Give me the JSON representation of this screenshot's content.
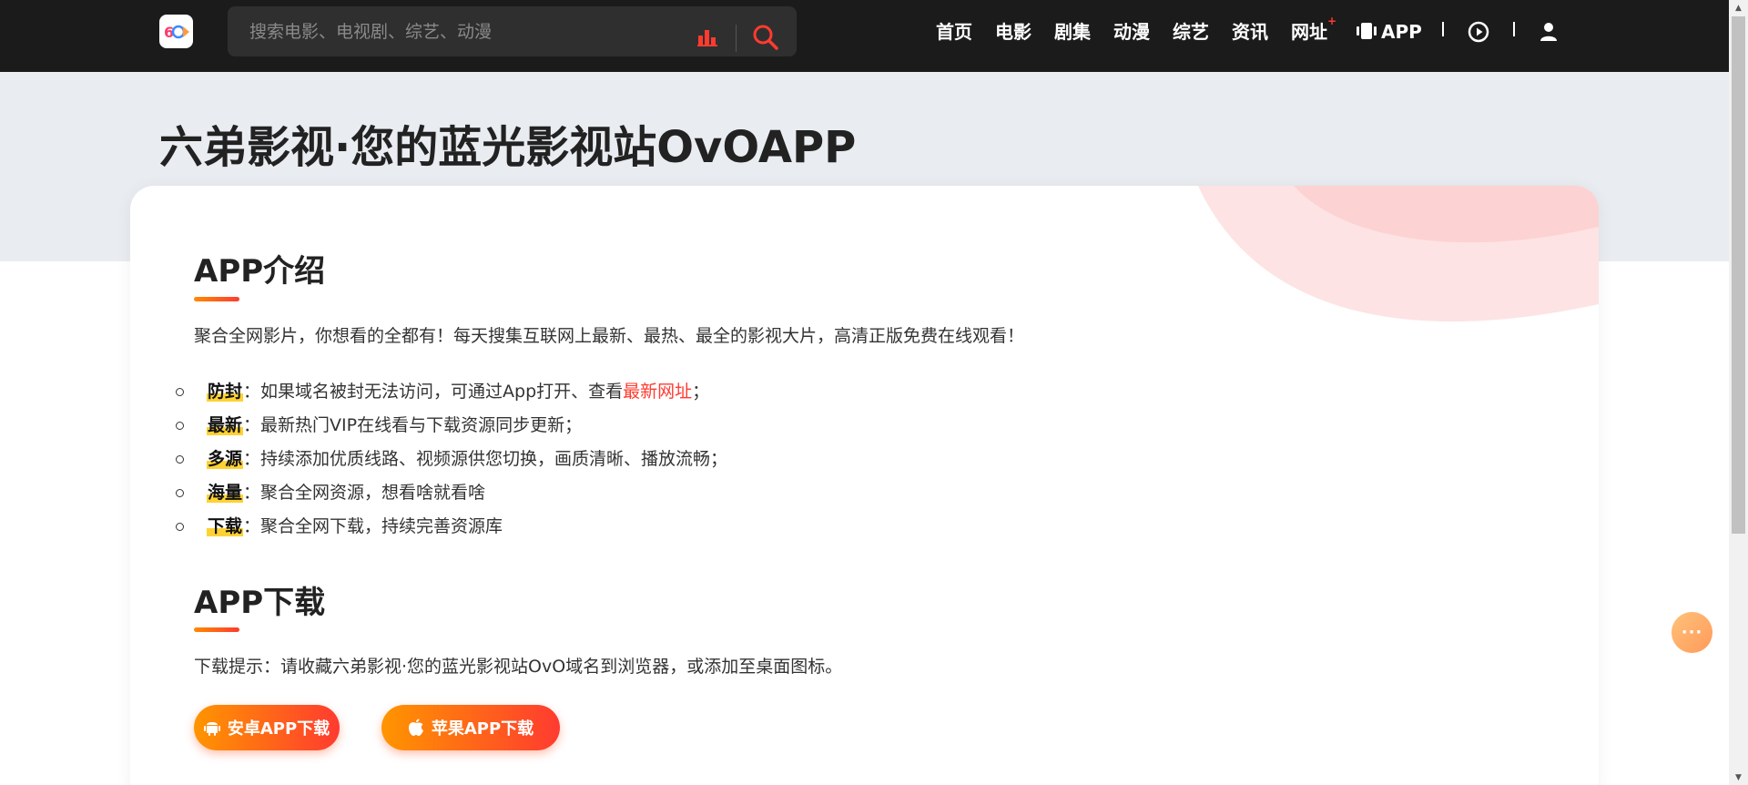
{
  "header": {
    "logo_alt": "六弟影视",
    "search": {
      "placeholder": "搜索电影、电视剧、综艺、动漫"
    },
    "nav": [
      {
        "label": "首页"
      },
      {
        "label": "电影"
      },
      {
        "label": "剧集"
      },
      {
        "label": "动漫"
      },
      {
        "label": "综艺"
      },
      {
        "label": "资讯"
      },
      {
        "label": "网址"
      },
      {
        "label": "APP"
      }
    ],
    "nav_badge": "+"
  },
  "page": {
    "title": "六弟影视·您的蓝光影视站OvOAPP"
  },
  "intro": {
    "heading": "APP介绍",
    "description": "聚合全网影片，你想看的全都有！每天搜集互联网上最新、最热、最全的影视大片，高清正版免费在线观看！",
    "features": [
      {
        "tag": "防封",
        "text_before": "：如果域名被封无法访问，可通过App打开、查看",
        "link": "最新网址",
        "text_after": "；"
      },
      {
        "tag": "最新",
        "text_before": "：最新热门VIP在线看与下载资源同步更新；",
        "link": "",
        "text_after": ""
      },
      {
        "tag": "多源",
        "text_before": "：持续添加优质线路、视频源供您切换，画质清晰、播放流畅；",
        "link": "",
        "text_after": ""
      },
      {
        "tag": "海量",
        "text_before": "：聚合全网资源，想看啥就看啥",
        "link": "",
        "text_after": ""
      },
      {
        "tag": "下载",
        "text_before": "：聚合全网下载，持续完善资源库",
        "link": "",
        "text_after": ""
      }
    ]
  },
  "download": {
    "heading": "APP下载",
    "tip": "下载提示：请收藏六弟影视·您的蓝光影视站OvO域名到浏览器，或添加至桌面图标。",
    "android_label": "安卓APP下载",
    "ios_label": "苹果APP下载"
  },
  "fab": {
    "label": "···"
  },
  "colors": {
    "accent": "#ff3b30",
    "accent_orange": "#ff9500",
    "highlight": "#ffd233",
    "header_bg": "#1b1b1b",
    "hero_bg": "#e9ecf0"
  }
}
